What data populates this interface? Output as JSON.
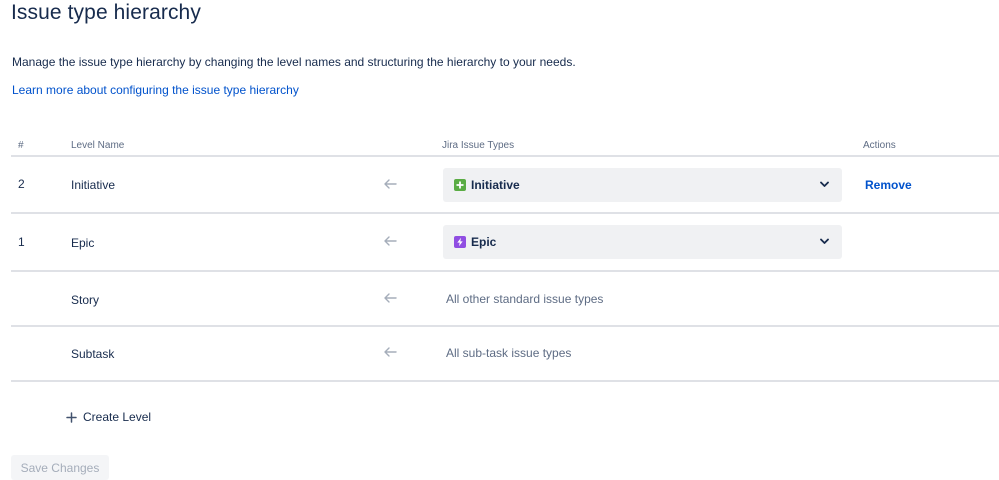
{
  "page": {
    "title": "Issue type hierarchy",
    "description": "Manage the issue type hierarchy by changing the level names and structuring the hierarchy to your needs.",
    "learn_more": "Learn more about configuring the issue type hierarchy"
  },
  "table": {
    "headers": {
      "num": "#",
      "level_name": "Level Name",
      "issue_types": "Jira Issue Types",
      "actions": "Actions"
    },
    "rows": [
      {
        "num": "2",
        "name": "Initiative",
        "issue_type": "Initiative",
        "issue_type_icon": "initiative-icon",
        "icon_color": "#5aac44",
        "action": "Remove"
      },
      {
        "num": "1",
        "name": "Epic",
        "issue_type": "Epic",
        "issue_type_icon": "epic-icon",
        "icon_color": "#904ee2"
      },
      {
        "num": "",
        "name": "Story",
        "issue_type_text": "All other standard issue types"
      },
      {
        "num": "",
        "name": "Subtask",
        "issue_type_text": "All sub-task issue types"
      }
    ]
  },
  "create_level": {
    "label": "Create Level",
    "icon": "plus-icon"
  },
  "save_button": {
    "label": "Save Changes",
    "state": "disabled"
  },
  "colors": {
    "link": "#0052cc",
    "divider": "#dfe1e6",
    "select_bg": "#f0f1f3"
  }
}
